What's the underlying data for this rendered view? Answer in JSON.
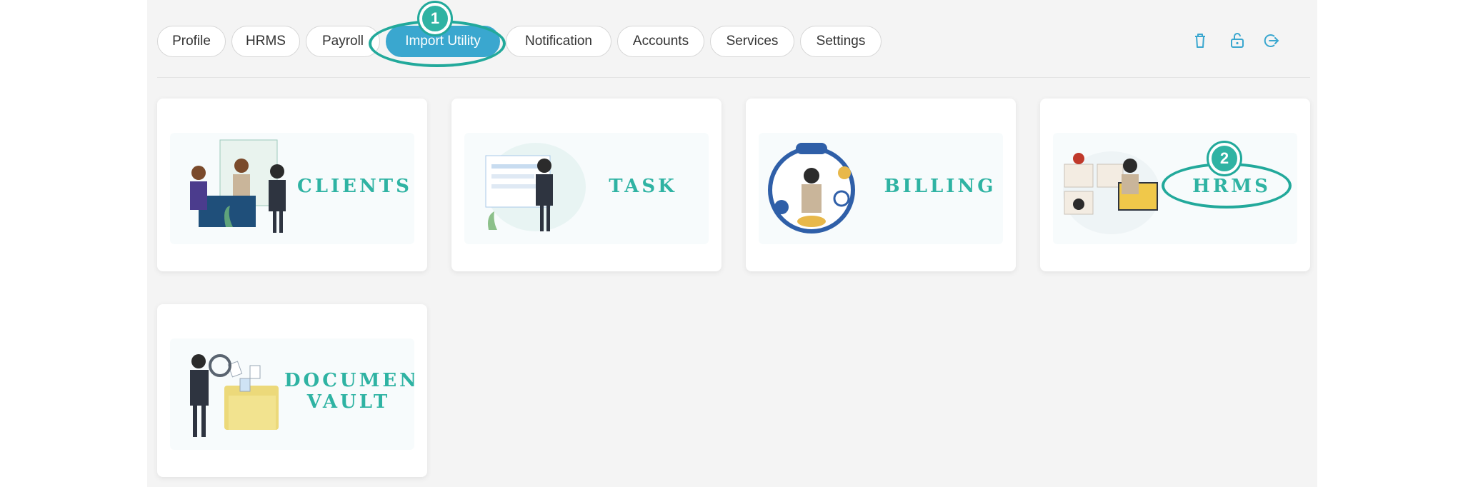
{
  "tabs": [
    {
      "label": "Profile",
      "active": false
    },
    {
      "label": "HRMS",
      "active": false
    },
    {
      "label": "Payroll",
      "active": false
    },
    {
      "label": "Import Utility",
      "active": true
    },
    {
      "label": "Notification",
      "active": false
    },
    {
      "label": "Accounts",
      "active": false
    },
    {
      "label": "Services",
      "active": false
    },
    {
      "label": "Settings",
      "active": false
    }
  ],
  "toolbar": {
    "icons": [
      "trash-icon",
      "unlock-icon",
      "logout-icon"
    ]
  },
  "cards": [
    {
      "label": "CLIENTS"
    },
    {
      "label": "TASK"
    },
    {
      "label": "BILLING"
    },
    {
      "label": "HRMS"
    },
    {
      "label_line1": "DOCUMENT",
      "label_line2": "VAULT"
    }
  ],
  "annotations": [
    {
      "number": "1"
    },
    {
      "number": "2"
    }
  ],
  "colors": {
    "accent": "#3aa7cf",
    "teal": "#2fb3a3",
    "background": "#f4f4f4"
  }
}
